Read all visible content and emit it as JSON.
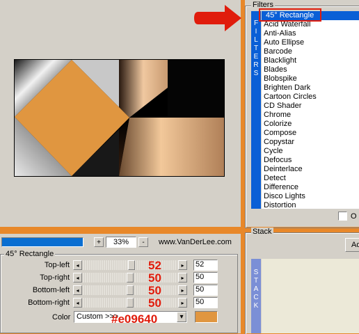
{
  "filters": {
    "title": "Filters",
    "side_letters": [
      "F",
      "I",
      "L",
      "T",
      "E",
      "R",
      "S"
    ],
    "items": [
      "45° Rectangle",
      "Acid Waterfall",
      "Anti-Alias",
      "Auto Ellipse",
      "Barcode",
      "Blacklight",
      "Blades",
      "Blobspike",
      "Brighten Dark",
      "Cartoon Circles",
      "CD Shader",
      "Chrome",
      "Colorize",
      "Compose",
      "Copystar",
      "Cycle",
      "Defocus",
      "Deinterlace",
      "Detect",
      "Difference",
      "Disco Lights",
      "Distortion"
    ],
    "selected_index": 0,
    "checkbox_label": "O"
  },
  "preview": {
    "zoom_out_label": "-",
    "zoom_in_label": "+",
    "zoom_value": "33%",
    "credit": "www.VanDerLee.com"
  },
  "stack": {
    "title": "Stack",
    "add_label": "Ad",
    "side_letters": [
      "S",
      "T",
      "A",
      "C",
      "K"
    ]
  },
  "params": {
    "title": "45° Rectangle",
    "rows": [
      {
        "label": "Top-left",
        "value": "52",
        "annotation": "52",
        "level": 0.52
      },
      {
        "label": "Top-right",
        "value": "50",
        "annotation": "50",
        "level": 0.5
      },
      {
        "label": "Bottom-left",
        "value": "50",
        "annotation": "50",
        "level": 0.5
      },
      {
        "label": "Bottom-right",
        "value": "50",
        "annotation": "50",
        "level": 0.5
      }
    ],
    "color_label": "Color",
    "color_select_value": "Custom >>>",
    "color_annotation": "#e09640",
    "swatch_color": "#e09640"
  },
  "arrow_color": "#e01c0c"
}
